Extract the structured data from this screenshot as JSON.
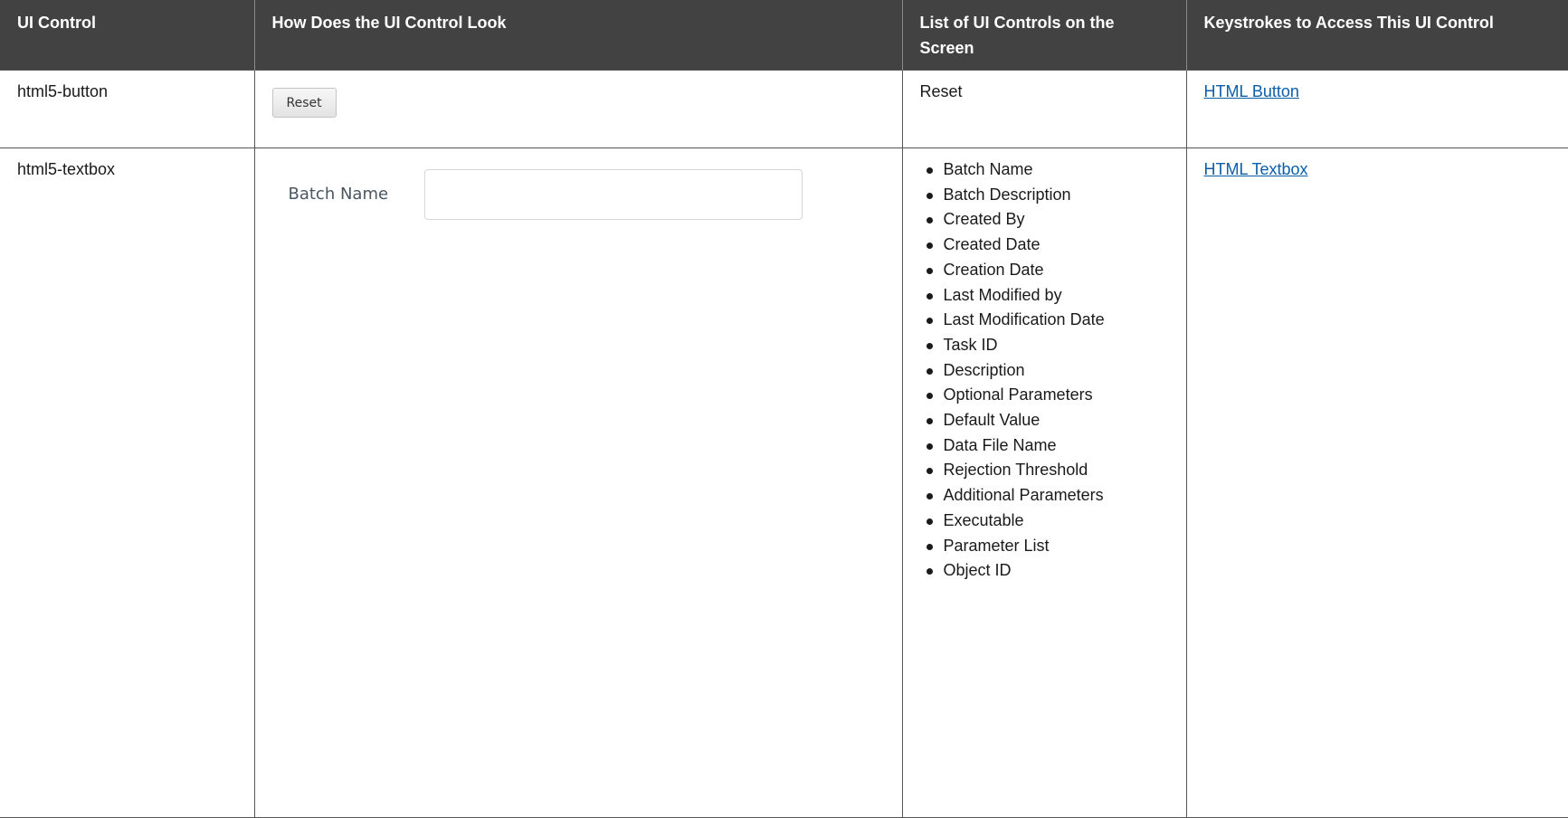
{
  "table": {
    "headers": [
      "UI Control",
      "How Does the UI Control Look",
      "List of UI Controls on the Screen",
      "Keystrokes to Access This UI Control"
    ],
    "rows": [
      {
        "control": "html5-button",
        "look": {
          "button_label": "Reset"
        },
        "list_text": "Reset",
        "link": "HTML Button"
      },
      {
        "control": "html5-textbox",
        "look": {
          "field_label": "Batch Name",
          "field_value": ""
        },
        "list": [
          "Batch Name",
          "Batch Description",
          "Created By",
          "Created Date",
          "Creation Date",
          "Last Modified by",
          "Last Modification Date",
          "Task ID",
          "Description",
          "Optional Parameters",
          "Default Value",
          "Data File Name",
          "Rejection Threshold",
          "Additional Parameters",
          "Executable",
          "Parameter List",
          "Object ID"
        ],
        "link": "HTML Textbox"
      }
    ]
  },
  "colors": {
    "header_bg": "#424242",
    "header_text": "#ffffff",
    "link": "#0b5ea8"
  }
}
